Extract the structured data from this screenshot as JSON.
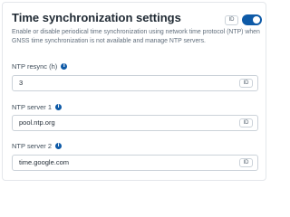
{
  "section": {
    "title": "Time synchronization settings",
    "description": "Enable or disable periodical time synchronization using network time protocol (NTP) when GNSS time synchronization is not available and manage NTP servers.",
    "toggle": {
      "badge": "ID",
      "enabled": true
    }
  },
  "fields": [
    {
      "label": "NTP resync (h)",
      "value": "3",
      "badge": "ID"
    },
    {
      "label": "NTP server 1",
      "value": "pool.ntp.org",
      "badge": "ID"
    },
    {
      "label": "NTP server 2",
      "value": "time.google.com",
      "badge": "ID"
    }
  ],
  "info_icon_glyph": "i",
  "colors": {
    "accent": "#0e5aa7",
    "border": "#cbd2d9",
    "title": "#1f2933",
    "muted": "#616e7c"
  }
}
